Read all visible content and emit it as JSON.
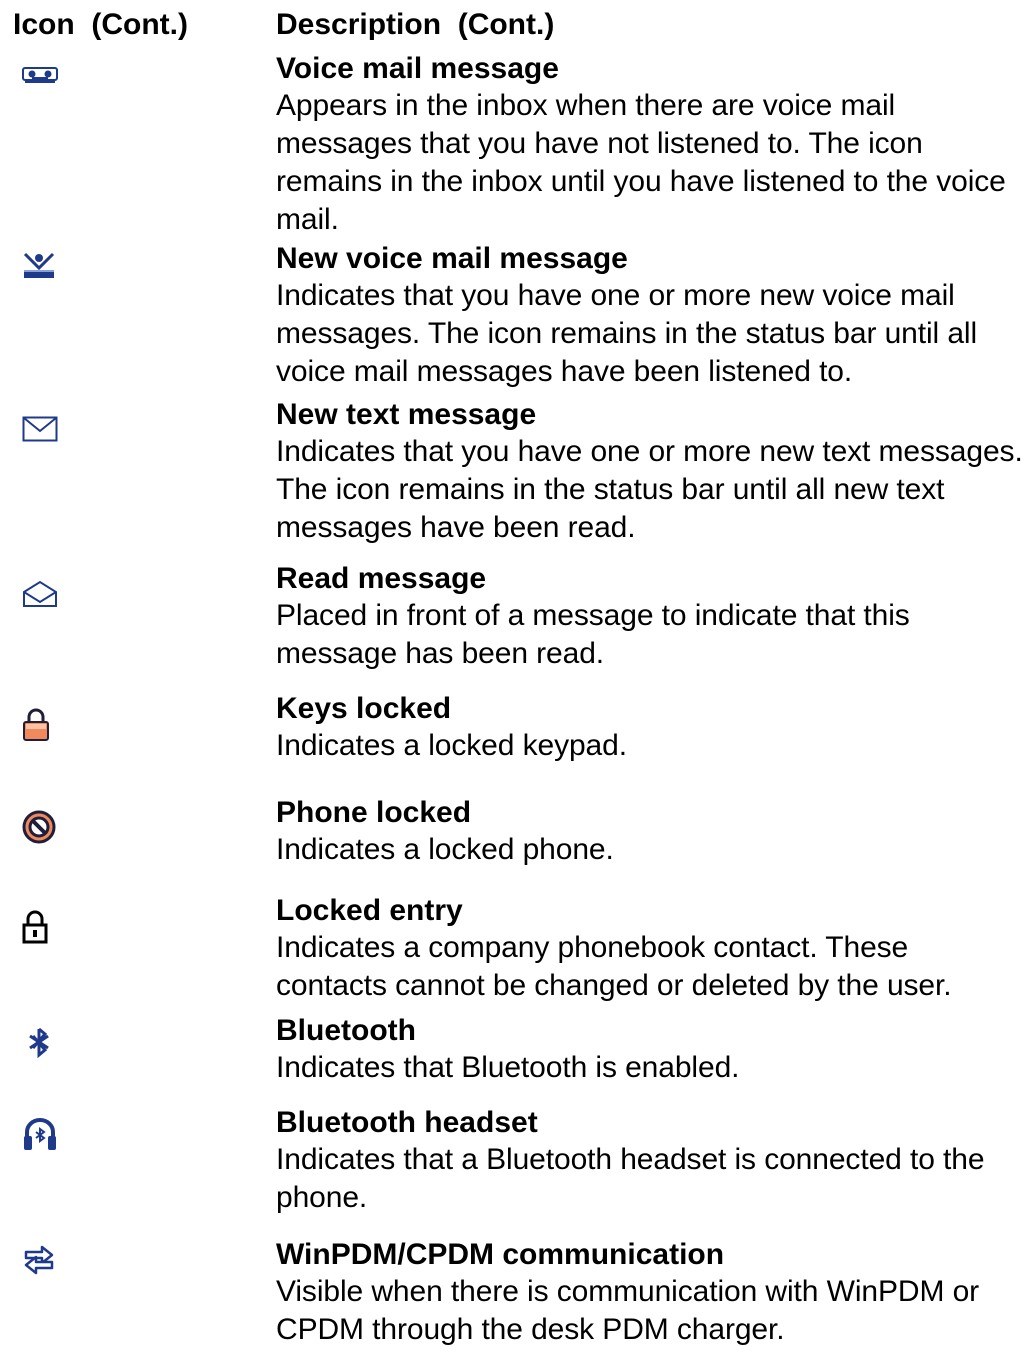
{
  "header": {
    "icon_col": "Icon  (Cont.)",
    "desc_col": "Description  (Cont.)"
  },
  "rows": [
    {
      "icon": "voicemail-message-icon",
      "title": "Voice mail message",
      "description": "Appears in the inbox when there are voice mail messages that you have not listened to. The icon remains in the inbox until you have listened to the voice mail."
    },
    {
      "icon": "new-voicemail-icon",
      "title": "New voice mail message",
      "description": "Indicates that you have one or more new voice mail messages. The icon remains in the status bar until all voice mail messages have been listened to."
    },
    {
      "icon": "envelope-icon",
      "title": "New text message",
      "description": "Indicates that you have one or more new text messages. The icon remains in the status bar until all new text messages have been read."
    },
    {
      "icon": "open-envelope-icon",
      "title": "Read message",
      "description": "Placed in front of a message to indicate that this message has been read."
    },
    {
      "icon": "padlock-icon",
      "title": "Keys locked",
      "description": "Indicates a locked keypad."
    },
    {
      "icon": "prohibited-icon",
      "title": "Phone locked",
      "description": "Indicates a locked phone."
    },
    {
      "icon": "lock-outline-icon",
      "title": "Locked entry",
      "description": "Indicates a company phonebook contact. These contacts cannot be changed or deleted by the user."
    },
    {
      "icon": "bluetooth-icon",
      "title": "Bluetooth",
      "description": "Indicates that Bluetooth is enabled."
    },
    {
      "icon": "bluetooth-headset-icon",
      "title": "Bluetooth headset",
      "description": "Indicates that a Bluetooth headset is connected to the phone."
    },
    {
      "icon": "pdm-communication-icon",
      "title": "WinPDM/CPDM communication",
      "description": "Visible when there is communication with WinPDM or CPDM through the desk PDM charger."
    }
  ],
  "colors": {
    "text": "#000000",
    "background": "#ffffff",
    "icon_blue": "#1f3a8a",
    "icon_lock_orange": "#f08a5d"
  }
}
